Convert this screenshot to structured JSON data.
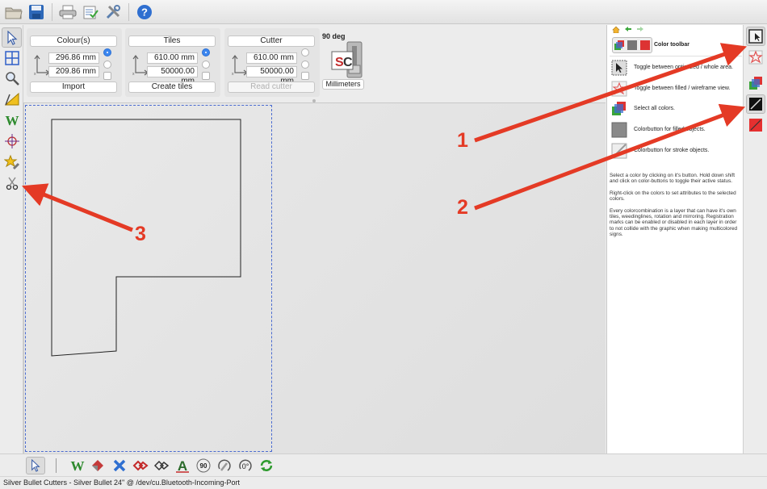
{
  "toolbar": {
    "buttons": [
      "open-icon",
      "save-icon",
      "print-icon",
      "checklist-icon",
      "tools-icon",
      "help-icon"
    ]
  },
  "left_tools": [
    "arrow-pointer-icon",
    "tiles-grid-icon",
    "zoom-icon",
    "ruler-triangle-icon",
    "weed-w-icon",
    "registration-mark-icon",
    "star-pencil-icon",
    "scissors-icon"
  ],
  "params": {
    "colours": {
      "header": "Colour(s)",
      "width": "296.86 mm",
      "height": "209.86 mm",
      "button": "Import"
    },
    "tiles": {
      "header": "Tiles",
      "width": "610.00 mm",
      "height": "50000.00 mm",
      "button": "Create tiles"
    },
    "cutter": {
      "header": "Cutter",
      "width": "610.00 mm",
      "height": "50000.00 mm",
      "button": "Read cutter"
    },
    "rotation_label": "90 deg",
    "units_button": "Millimeters"
  },
  "help": {
    "title": "Color toolbar",
    "rows": [
      {
        "icon": "optimized-area-icon",
        "text": "Toggle between optimized / whole area."
      },
      {
        "icon": "filled-wireframe-icon",
        "text": "Toggle between filled / wireframe view."
      },
      {
        "icon": "select-all-colors-icon",
        "text": "Select all colors."
      },
      {
        "icon": "fill-colorbutton-icon",
        "text": "Colorbutton for filled objects."
      },
      {
        "icon": "stroke-colorbutton-icon",
        "text": "Colorbutton for stroke objects."
      }
    ],
    "para1": "Select a color by clicking on it's button. Hold down shift and click on color-buttons to toggle their active status.",
    "para2": "Right-click on the colors to set attributes to the selected colors.",
    "para3": "Every colorcombination is a layer that can have it's own tiles, weedinglines, rotation and mirroring. Registration marks can be enabled or disabled in each layer in order to not collide with the graphic when making multicolored signs."
  },
  "right_strip": [
    "optimized-area-icon",
    "filled-wireframe-icon",
    "select-all-colors-icon",
    "fill-black-icon",
    "stroke-red-icon"
  ],
  "bottom_toolbar": [
    "arrow-pointer-icon",
    "weed-w-icon",
    "weed-diamond-icon",
    "delete-x-icon",
    "node-red-icon",
    "node-outline-icon",
    "text-a-icon",
    "rotate-90-icon",
    "rotate-free-icon",
    "rotate-0-icon",
    "refresh-icon"
  ],
  "annotations": {
    "callout1": "1",
    "callout2": "2",
    "callout3": "3"
  },
  "status": "Silver Bullet Cutters - Silver Bullet 24\" @ /dev/cu.Bluetooth-Incoming-Port",
  "colors": {
    "accent_blue": "#3b86ef",
    "arrow_red": "#e43a25",
    "work_area_border": "#4b6cd0"
  }
}
